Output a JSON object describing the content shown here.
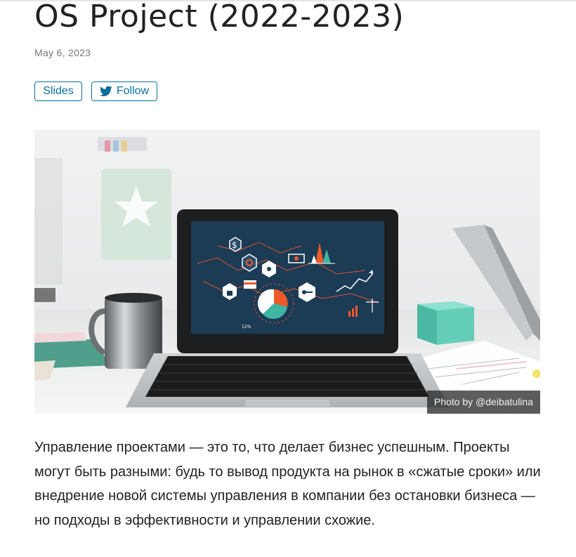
{
  "article": {
    "title": "OS Project (2022-2023)",
    "date": "May 6, 2023",
    "paragraph": "Управление проектами — это то, что делает бизнес успешным. Проекты могут быть разными: будь то вывод продукта на рынок в «сжатые сроки» или внедрение новой системы управления в компании без остановки бизнеса — но подходы в эффективности и управлении схожие."
  },
  "actions": {
    "slides_label": "Slides",
    "follow_label": "Follow",
    "follow_icon": "twitter-icon"
  },
  "hero": {
    "caption": "Photo by @deibatulina",
    "screen_label": "12%",
    "screen_icons": [
      "dollar-icon",
      "refresh-icon",
      "pointer-icon",
      "banknote-icon",
      "lock-icon",
      "card-icon",
      "key-icon",
      "scales-icon",
      "pie-chart-icon",
      "line-chart-icon"
    ]
  },
  "colors": {
    "accent": "#0d6f99",
    "screen": "#1c3b55",
    "pie_orange": "#f05a28",
    "pie_teal": "#3fb5a3"
  }
}
